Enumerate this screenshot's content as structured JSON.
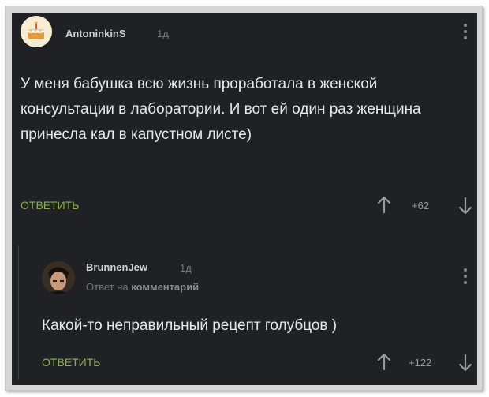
{
  "comment": {
    "author": "AntoninkinS",
    "time": "1д",
    "text": "У меня бабушка всю жизнь проработала в женской консультации в лаборатории. И вот ей один раз женщина принесла кал в капустном листе)",
    "reply_label": "ОТВЕТИТЬ",
    "score": "+62",
    "avatar_icon": "cake-avatar-icon"
  },
  "reply": {
    "author": "BrunnenJew",
    "time": "1д",
    "reply_to_prefix": "Ответ на",
    "reply_to_target": "комментарий",
    "text": "Какой-то неправильный рецепт голубцов )",
    "reply_label": "ОТВЕТИТЬ",
    "score": "+122",
    "avatar_icon": "man-portrait-avatar-icon"
  },
  "colors": {
    "background": "#202124",
    "reply_link": "#8bb04b",
    "text": "#e8e8e8",
    "muted": "#777777"
  }
}
